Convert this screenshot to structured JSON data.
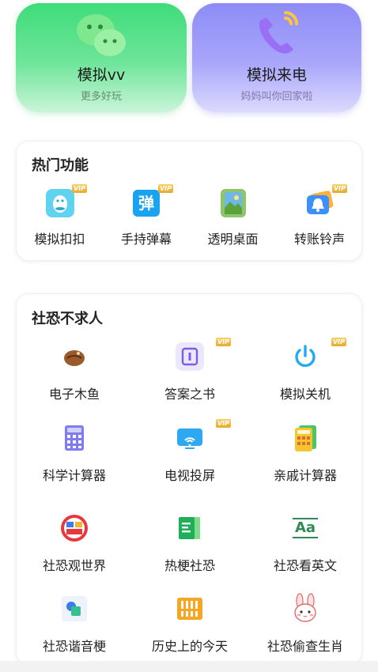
{
  "top_cards": [
    {
      "title": "模拟vv",
      "subtitle": "更多好玩",
      "icon": "wechat-icon",
      "color": "#3fdc7a"
    },
    {
      "title": "模拟来电",
      "subtitle": "妈妈叫你回家啦",
      "icon": "phone-call-icon",
      "color": "#8d8cf6"
    }
  ],
  "hot": {
    "title": "热门功能",
    "items": [
      {
        "label": "模拟扣扣",
        "icon": "qq-penguin-icon",
        "vip": "VIP"
      },
      {
        "label": "手持弹幕",
        "icon": "danmaku-icon",
        "glyph": "弹",
        "vip": "VIP"
      },
      {
        "label": "透明桌面",
        "icon": "transparent-phone-icon",
        "vip": ""
      },
      {
        "label": "转账铃声",
        "icon": "bell-card-icon",
        "vip": "VIP"
      }
    ]
  },
  "social": {
    "title": "社恐不求人",
    "items": [
      {
        "label": "电子木鱼",
        "icon": "wooden-fish-icon",
        "vip": ""
      },
      {
        "label": "答案之书",
        "icon": "answer-book-icon",
        "vip": "VIP"
      },
      {
        "label": "模拟关机",
        "icon": "power-icon",
        "vip": "VIP"
      },
      {
        "label": "科学计算器",
        "icon": "calculator-icon",
        "vip": ""
      },
      {
        "label": "电视投屏",
        "icon": "screen-cast-icon",
        "vip": "VIP"
      },
      {
        "label": "亲戚计算器",
        "icon": "relative-calculator-icon",
        "vip": ""
      },
      {
        "label": "社恐观世界",
        "icon": "world-view-icon",
        "vip": ""
      },
      {
        "label": "热梗社恐",
        "icon": "meme-book-icon",
        "vip": ""
      },
      {
        "label": "社恐看英文",
        "icon": "english-text-icon",
        "glyph": "Aa",
        "vip": ""
      },
      {
        "label": "社恐谐音梗",
        "icon": "homophone-icon",
        "vip": ""
      },
      {
        "label": "历史上的今天",
        "icon": "history-calendar-icon",
        "vip": ""
      },
      {
        "label": "社恐偷查生肖",
        "icon": "rabbit-zodiac-icon",
        "vip": ""
      }
    ]
  }
}
